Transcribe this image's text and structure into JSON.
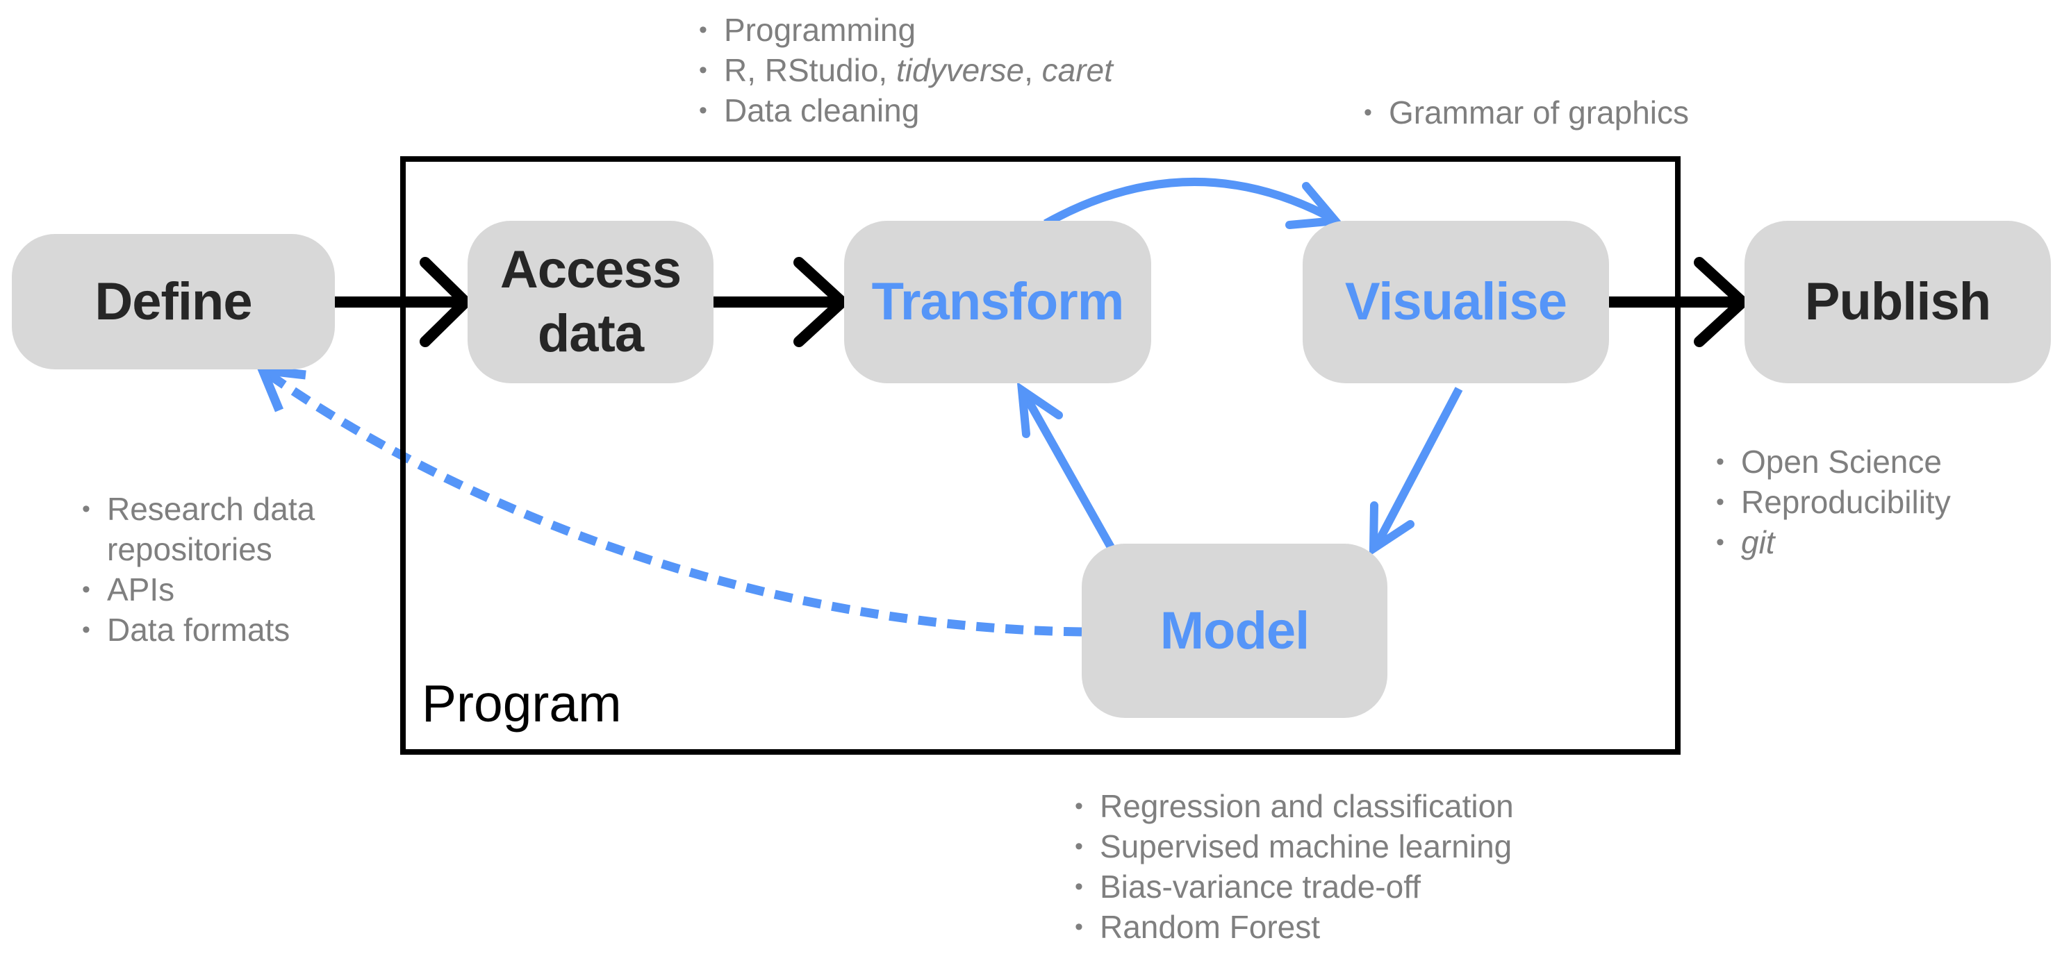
{
  "colors": {
    "box_fill": "#d8d8d8",
    "dark_text": "#262626",
    "accent_blue": "#5595f8",
    "bullet_text": "#7f7f7f",
    "frame": "#000000"
  },
  "stages": {
    "define": "Define",
    "access_line1": "Access",
    "access_line2": "data",
    "transform": "Transform",
    "visualise": "Visualise",
    "model": "Model",
    "publish": "Publish"
  },
  "program_label": "Program",
  "notes": {
    "access": [
      {
        "text": "Programming"
      },
      {
        "parts": [
          {
            "text": "R, RStudio, ",
            "italic": false
          },
          {
            "text": "tidyverse",
            "italic": true
          },
          {
            "text": ", ",
            "italic": false
          },
          {
            "text": "caret",
            "italic": true
          }
        ]
      },
      {
        "text": "Data cleaning"
      }
    ],
    "visualise": [
      {
        "text": "Grammar of graphics"
      }
    ],
    "define": [
      {
        "text": "Research data",
        "cont": "repositories"
      },
      {
        "text": "APIs"
      },
      {
        "text": "Data formats"
      }
    ],
    "model": [
      {
        "text": "Regression and classification"
      },
      {
        "text": "Supervised machine learning"
      },
      {
        "text": "Bias-variance trade-off"
      },
      {
        "text": "Random Forest"
      }
    ],
    "publish": [
      {
        "text": "Open Science"
      },
      {
        "text": "Reproducibility"
      },
      {
        "text": "git",
        "italic": true
      }
    ]
  },
  "bullet_char": "•",
  "edges": [
    {
      "from": "Define",
      "to": "Access data",
      "style": "solid",
      "color": "black"
    },
    {
      "from": "Access data",
      "to": "Transform",
      "style": "solid",
      "color": "black"
    },
    {
      "from": "Transform",
      "to": "Visualise",
      "style": "solid",
      "color": "blue"
    },
    {
      "from": "Visualise",
      "to": "Model",
      "style": "solid",
      "color": "blue"
    },
    {
      "from": "Model",
      "to": "Transform",
      "style": "solid",
      "color": "blue"
    },
    {
      "from": "Visualise",
      "to": "Publish",
      "style": "solid",
      "color": "black"
    },
    {
      "from": "Model",
      "to": "Define",
      "style": "dashed",
      "color": "blue"
    }
  ]
}
